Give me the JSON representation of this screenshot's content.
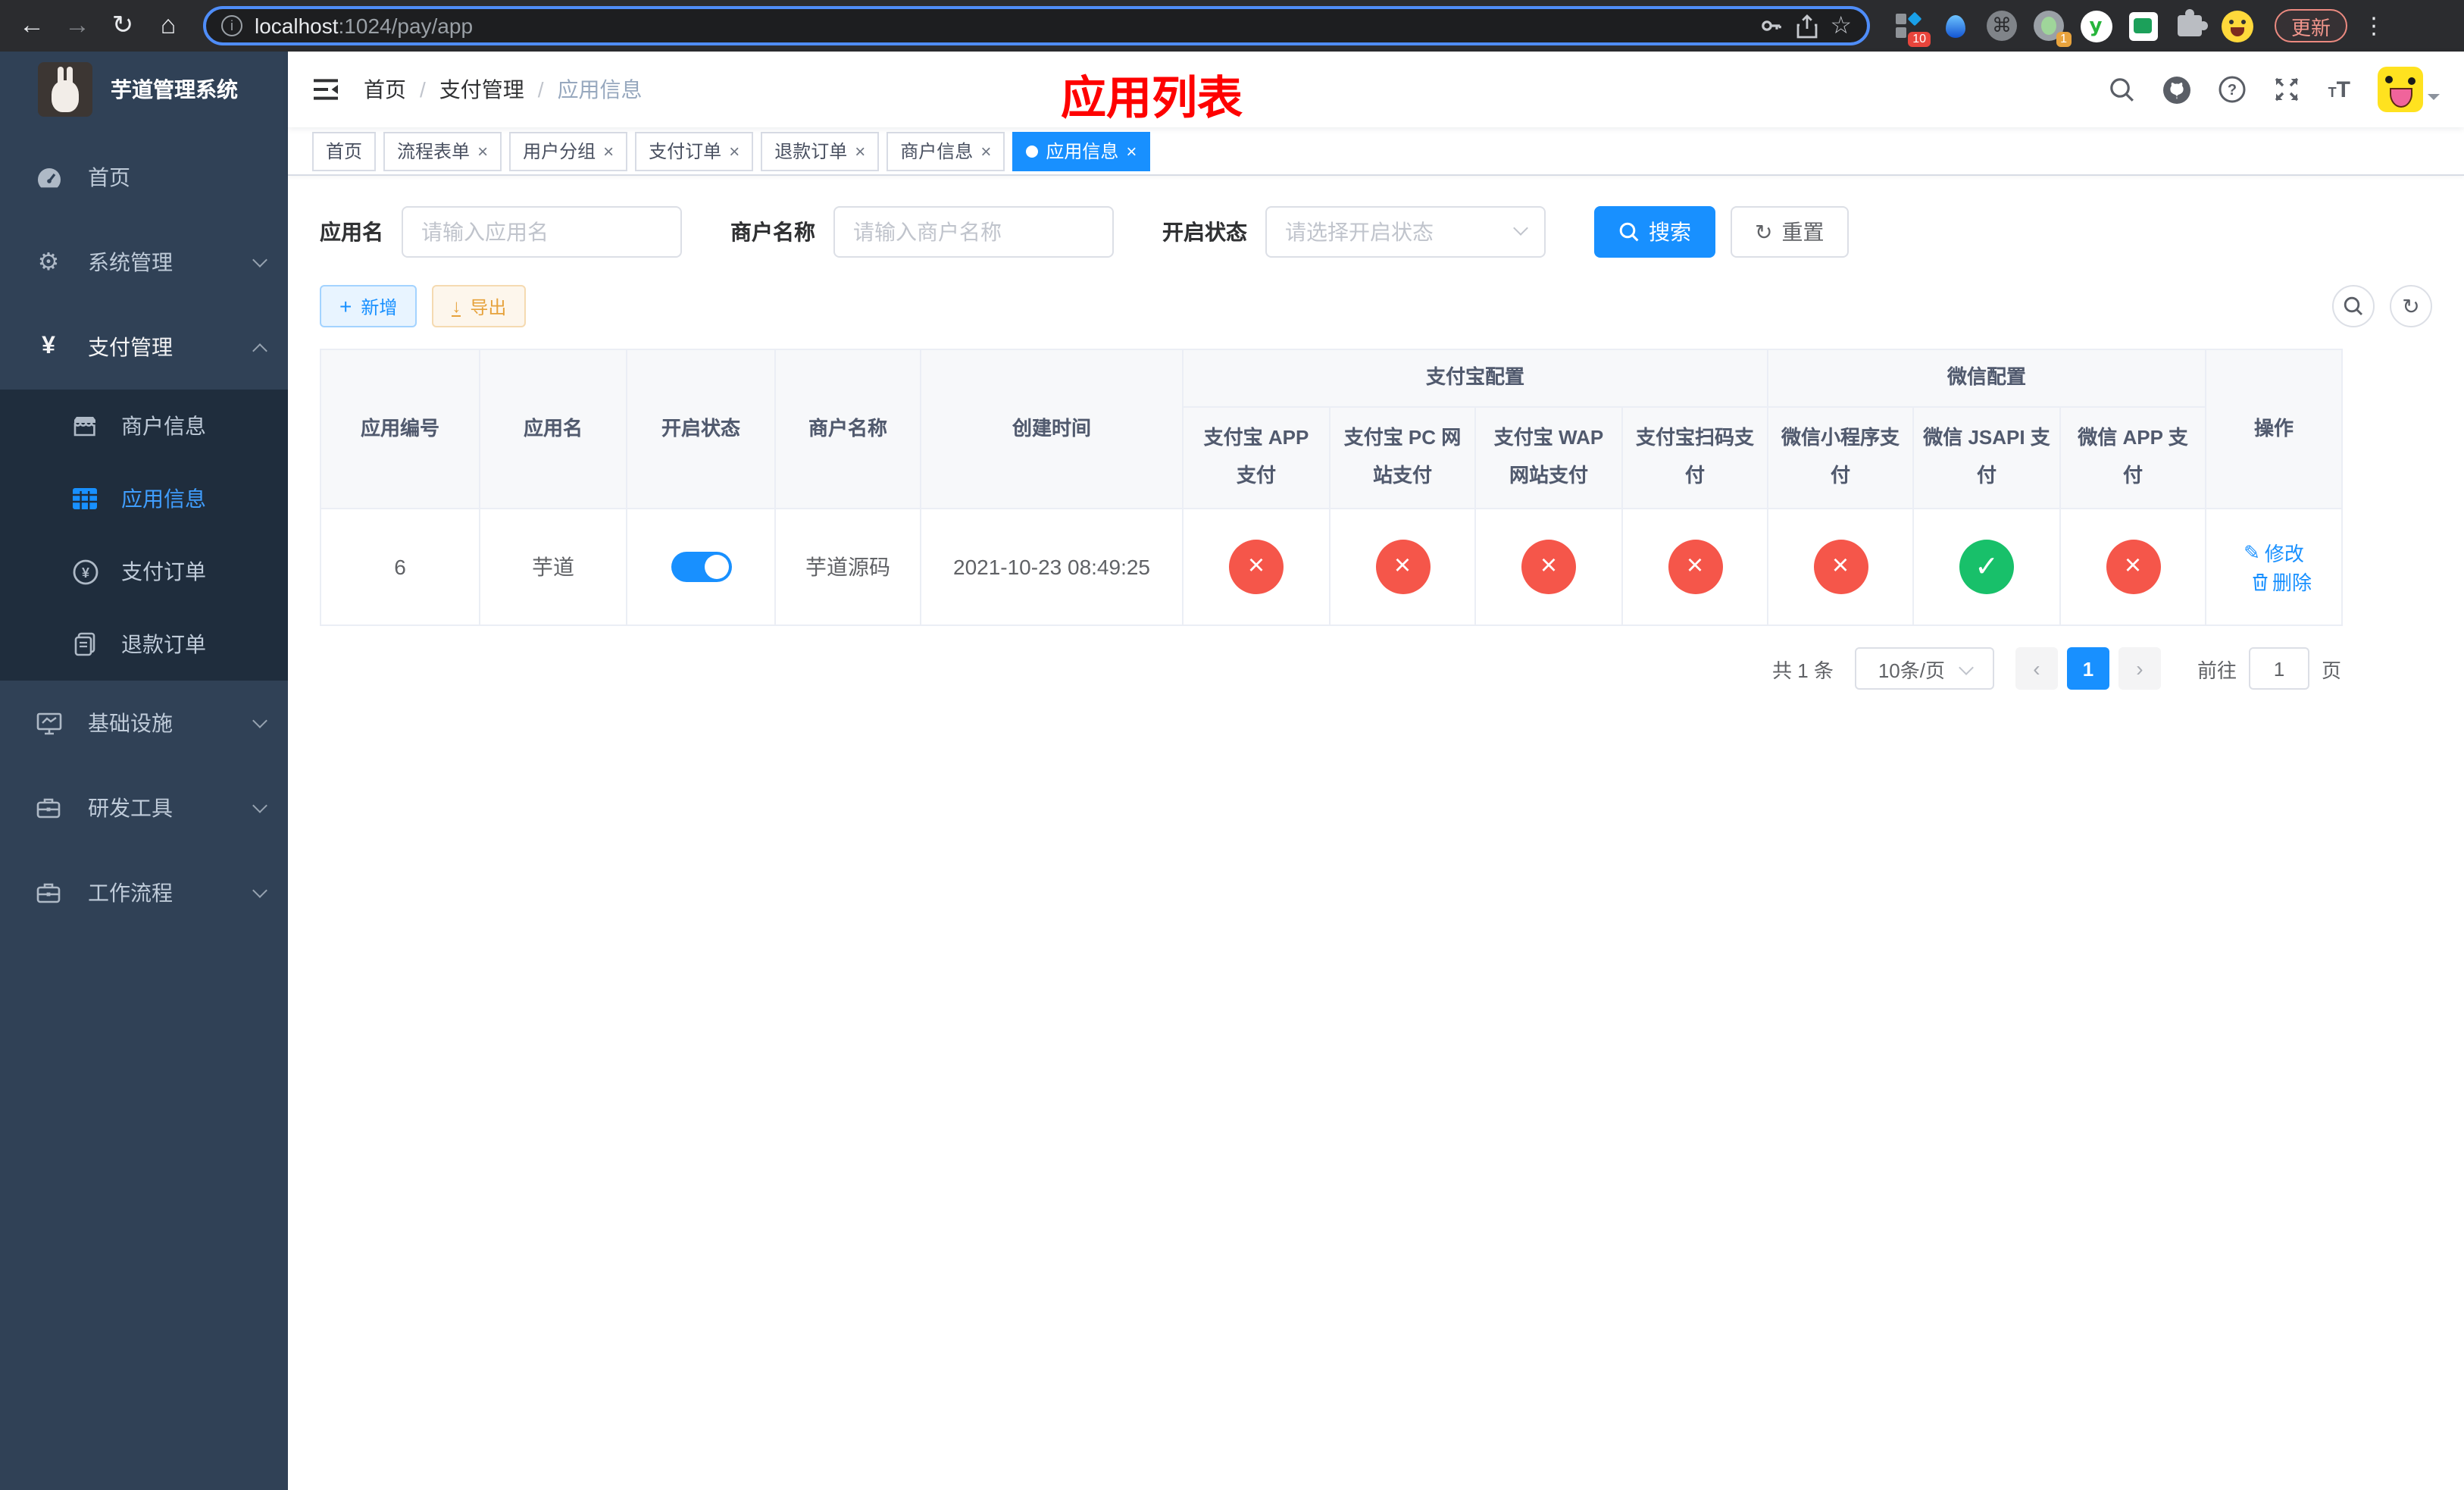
{
  "glyphs": {
    "back": "←",
    "forward": "→",
    "reload": "↻",
    "home": "⌂",
    "star": "☆",
    "dots": "⋮",
    "command": "⌘",
    "info": "i",
    "gear": "⚙",
    "yen": "¥",
    "plus": "+",
    "download": "↓",
    "reset": "↻",
    "refresh": "↻",
    "edit": "✎",
    "check": "✓",
    "close": "×",
    "chevron_left": "‹",
    "chevron_right": "›",
    "question": "?",
    "ext_y": "y",
    "tsize_small": "T",
    "tsize_big": "T"
  },
  "browser": {
    "url_host": "localhost",
    "url_rest": ":1024/pay/app",
    "update_label": "更新",
    "badge_ten": "10",
    "badge_one": "1"
  },
  "sidebar": {
    "title": "芋道管理系统",
    "home": "首页",
    "system": "系统管理",
    "pay": "支付管理",
    "sub_merchant": "商户信息",
    "sub_app": "应用信息",
    "sub_order": "支付订单",
    "sub_refund": "退款订单",
    "infra": "基础设施",
    "dev": "研发工具",
    "workflow": "工作流程"
  },
  "navbar": {
    "breadcrumb": [
      "首页",
      "支付管理",
      "应用信息"
    ],
    "overlay_title": "应用列表"
  },
  "tabs": [
    {
      "label": "首页"
    },
    {
      "label": "流程表单"
    },
    {
      "label": "用户分组"
    },
    {
      "label": "支付订单"
    },
    {
      "label": "退款订单"
    },
    {
      "label": "商户信息"
    },
    {
      "label": "应用信息"
    }
  ],
  "filters": {
    "app_name_label": "应用名",
    "app_name_placeholder": "请输入应用名",
    "merchant_label": "商户名称",
    "merchant_placeholder": "请输入商户名称",
    "status_label": "开启状态",
    "status_placeholder": "请选择开启状态",
    "search": "搜索",
    "reset": "重置"
  },
  "toolbar": {
    "add": "新增",
    "export": "导出"
  },
  "table": {
    "group_alipay": "支付宝配置",
    "group_wechat": "微信配置",
    "col_action": "操作",
    "columns": [
      "应用编号",
      "应用名",
      "开启状态",
      "商户名称",
      "创建时间",
      "支付宝 APP 支付",
      "支付宝 PC 网站支付",
      "支付宝 WAP 网站支付",
      "支付宝扫码支付",
      "微信小程序支付",
      "微信 JSAPI 支付",
      "微信 APP 支付"
    ],
    "row": {
      "id": "6",
      "name": "芋道",
      "enabled": "on",
      "merchant": "芋道源码",
      "created": "2021-10-23 08:49:25",
      "statuses": [
        "no",
        "no",
        "no",
        "no",
        "no",
        "yes",
        "no"
      ],
      "edit": "修改",
      "remove": "删除"
    }
  },
  "pagination": {
    "total": "共 1 条",
    "page_size": "10条/页",
    "page": "1",
    "go_prefix": "前往",
    "go_value": "1",
    "go_suffix": "页"
  },
  "colors": {
    "primary": "#1890ff",
    "sidebar_active": "#409eff",
    "danger": "#f5564a",
    "success": "#18c06a",
    "warning": "#e6a23c",
    "annotation": "#fe0100"
  }
}
